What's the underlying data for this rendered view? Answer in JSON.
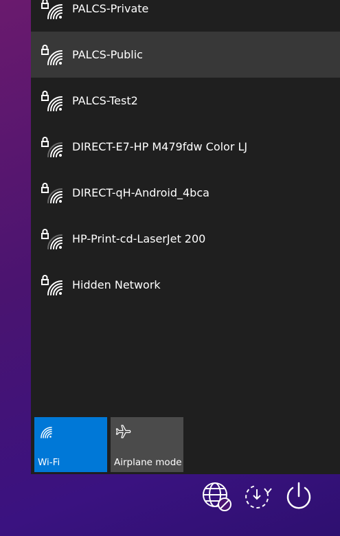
{
  "networks": [
    {
      "name": "PALCS-Private",
      "secured": true,
      "signal": "full",
      "selected": false
    },
    {
      "name": "PALCS-Public",
      "secured": true,
      "signal": "full",
      "selected": true
    },
    {
      "name": "PALCS-Test2",
      "secured": true,
      "signal": "full",
      "selected": false
    },
    {
      "name": "DIRECT-E7-HP M479fdw Color LJ",
      "secured": true,
      "signal": "medium",
      "selected": false
    },
    {
      "name": "DIRECT-qH-Android_4bca",
      "secured": true,
      "signal": "medium",
      "selected": false
    },
    {
      "name": "HP-Print-cd-LaserJet 200",
      "secured": true,
      "signal": "medium",
      "selected": false
    },
    {
      "name": "Hidden Network",
      "secured": true,
      "signal": "full",
      "selected": false
    }
  ],
  "quick_actions": {
    "wifi": {
      "label": "Wi-Fi",
      "icon": "wifi-icon",
      "active": true,
      "color": "#0078d7"
    },
    "airplane": {
      "label": "Airplane mode",
      "icon": "airplane-icon",
      "active": false,
      "color": "#4b4b4b"
    }
  },
  "system_icons": [
    {
      "name": "network-disconnected-icon"
    },
    {
      "name": "update-restart-icon"
    },
    {
      "name": "power-icon"
    }
  ],
  "colors": {
    "panel": "#1f1f1f",
    "selected_row": "#383838",
    "accent": "#0078d7",
    "text": "#ffffff"
  }
}
